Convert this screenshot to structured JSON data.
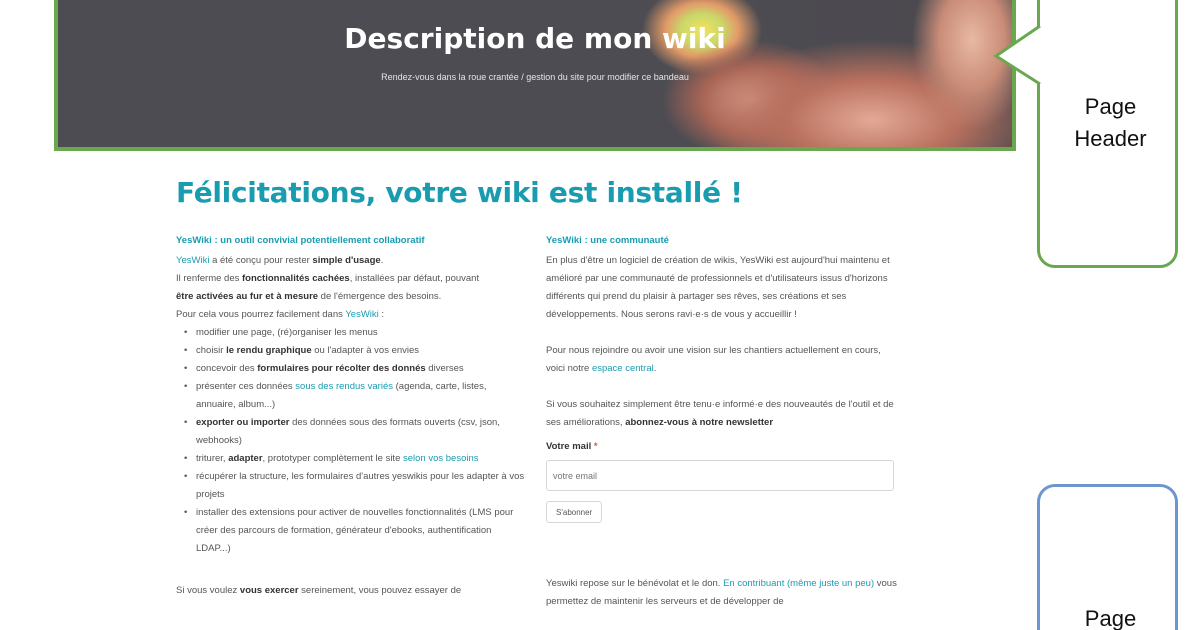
{
  "header": {
    "title": "Description de mon wiki",
    "subtitle": "Rendez-vous dans la roue crantée / gestion du site pour modifier ce bandeau"
  },
  "annotations": {
    "header_label_line1": "Page",
    "header_label_line2": "Header",
    "page_label_line1": "Page",
    "header_color": "#6aa84f",
    "page_color": "#6d95d0"
  },
  "main": {
    "title": "Félicitations, votre wiki est installé !",
    "left": {
      "heading": "YesWiki : un outil convivial potentiellement collaboratif",
      "intro": [
        {
          "link": "YesWiki",
          "t1": " a été conçu pour rester ",
          "b1": "simple d'usage",
          "t2": "."
        },
        {
          "t1": "Il renferme des ",
          "b1": "fonctionnalités cachées",
          "t2": ", installées par défaut, pouvant"
        },
        {
          "b1": "être activées au fur et à mesure",
          "t2": " de l'émergence des besoins."
        },
        {
          "t1": "Pour cela vous pourrez facilement dans ",
          "link": "YesWiki",
          "t2": " :"
        }
      ],
      "bullets": [
        "modifier une page, (ré)organiser les menus",
        "choisir le rendu graphique ou l'adapter à vos envies",
        "concevoir des formulaires pour récolter des donnés diverses",
        "présenter ces données sous des rendus variés (agenda, carte, listes, annuaire, album...)",
        "exporter ou importer des données sous des formats ouverts (csv, json, webhooks)",
        "triturer, adapter, prototyper complètement le site selon vos besoins",
        "récupérer la structure, les formulaires d'autres yeswikis pour les adapter à vos projets",
        "installer des extensions pour activer de nouvelles fonctionnalités (LMS pour créer des parcours de formation, générateur d'ebooks, authentification LDAP...)"
      ],
      "bullet_parts": {
        "b2_pre": "choisir ",
        "b2_bold": "le rendu graphique",
        "b2_post": " ou l'adapter à vos envies",
        "b3_pre": "concevoir des ",
        "b3_bold": "formulaires pour récolter des donnés",
        "b3_post": " diverses",
        "b4_pre": "présenter ces données ",
        "b4_link": "sous des rendus variés",
        "b4_post": " (agenda, carte, listes, annuaire, album...)",
        "b5_bold": "exporter ou importer",
        "b5_post": " des données sous des formats ouverts (csv, json, webhooks)",
        "b6_pre": "triturer, ",
        "b6_bold": "adapter",
        "b6_mid": ", prototyper complètement le site ",
        "b6_link": "selon vos besoins"
      },
      "outro_pre": "Si vous voulez ",
      "outro_bold": "vous exercer",
      "outro_post": " sereinement, vous pouvez essayer de"
    },
    "right": {
      "heading": "YesWiki : une communauté",
      "p1": "En plus d'être un logiciel de création de wikis, YesWiki est aujourd'hui maintenu et amélioré par une communauté de professionnels et d'utilisateurs issus d'horizons différents qui prend du plaisir à partager ses rêves, ses créations et ses développements. Nous serons ravi·e·s de vous y accueillir !",
      "p2_pre": "Pour nous rejoindre ou avoir une vision sur les chantiers actuellement en cours, voici notre ",
      "p2_link": "espace central",
      "p2_post": ".",
      "p3_pre": "Si vous souhaitez simplement être tenu·e informé·e des nouveautés de l'outil et de ses améliorations, ",
      "p3_bold": "abonnez-vous à notre newsletter",
      "mail_label": "Votre mail",
      "mail_required": "*",
      "mail_placeholder": "votre email",
      "subscribe_label": "S'abonner",
      "p4_pre": "Yeswiki repose sur le bénévolat et le don. ",
      "p4_link": "En contribuant (même juste un peu)",
      "p4_post": " vous permettez de maintenir les serveurs et de développer de"
    }
  }
}
